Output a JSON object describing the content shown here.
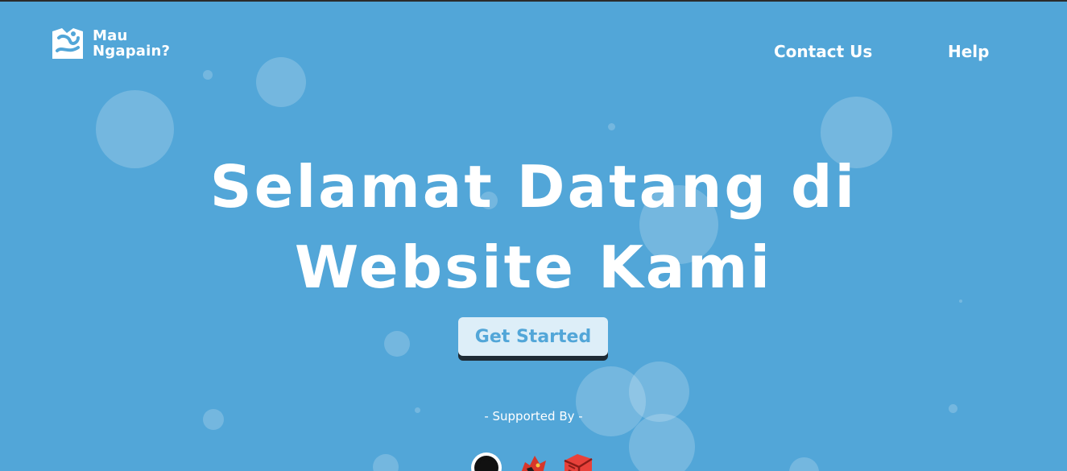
{
  "brand": {
    "line1": "Mau",
    "line2": "Ngapain?"
  },
  "nav": {
    "contact": "Contact Us",
    "help": "Help"
  },
  "hero": {
    "line1": "Selamat Datang di",
    "line2": "Website Kami"
  },
  "cta": {
    "label": "Get Started"
  },
  "supported": {
    "label": "- Supported By -"
  },
  "sponsors": [
    "github-icon",
    "dragon-icon",
    "laravel-icon"
  ],
  "colors": {
    "background": "#52a6d8",
    "button_bg": "#ddeef8",
    "button_shadow": "#1e2b35"
  }
}
